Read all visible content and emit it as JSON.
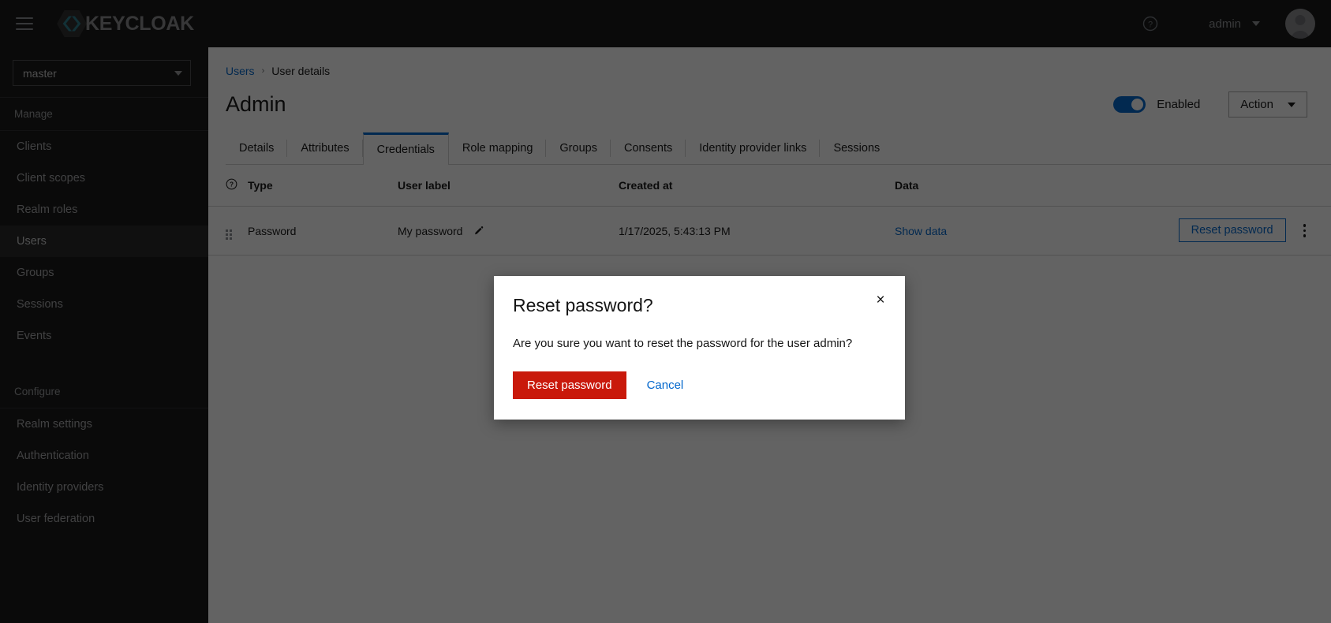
{
  "masthead": {
    "menu_toggle": "hamburger-menu",
    "brand": "KEYCLOAK",
    "help_label": "?",
    "user_name": "admin"
  },
  "sidebar": {
    "realm": {
      "selected": "master"
    },
    "groups": [
      {
        "title": "Manage",
        "items": [
          {
            "label": "Clients",
            "active": false
          },
          {
            "label": "Client scopes",
            "active": false
          },
          {
            "label": "Realm roles",
            "active": false
          },
          {
            "label": "Users",
            "active": true
          },
          {
            "label": "Groups",
            "active": false
          },
          {
            "label": "Sessions",
            "active": false
          },
          {
            "label": "Events",
            "active": false
          }
        ]
      },
      {
        "title": "Configure",
        "items": [
          {
            "label": "Realm settings",
            "active": false
          },
          {
            "label": "Authentication",
            "active": false
          },
          {
            "label": "Identity providers",
            "active": false
          },
          {
            "label": "User federation",
            "active": false
          }
        ]
      }
    ]
  },
  "breadcrumb": {
    "parent": "Users",
    "separator": "›",
    "current": "User details"
  },
  "page": {
    "title": "Admin",
    "enabled_label": "Enabled",
    "enabled": true,
    "action_label": "Action"
  },
  "tabs": [
    {
      "label": "Details",
      "active": false
    },
    {
      "label": "Attributes",
      "active": false
    },
    {
      "label": "Credentials",
      "active": true
    },
    {
      "label": "Role mapping",
      "active": false
    },
    {
      "label": "Groups",
      "active": false
    },
    {
      "label": "Consents",
      "active": false
    },
    {
      "label": "Identity provider links",
      "active": false
    },
    {
      "label": "Sessions",
      "active": false
    }
  ],
  "credentials_table": {
    "columns": [
      "",
      "Type",
      "User label",
      "Created at",
      "Data",
      ""
    ],
    "rows": [
      {
        "type": "Password",
        "user_label": "My password",
        "created_at": "1/17/2025, 5:43:13 PM",
        "data_link": "Show data",
        "reset_label": "Reset password"
      }
    ]
  },
  "modal": {
    "title": "Reset password?",
    "body": "Are you sure you want to reset the password for the user admin?",
    "confirm_label": "Reset password",
    "cancel_label": "Cancel",
    "close_label": "×"
  },
  "colors": {
    "brand_dark": "#151515",
    "accent_blue": "#0066cc",
    "danger_red": "#c9190b",
    "brand_teal": "#2a7d8c"
  }
}
